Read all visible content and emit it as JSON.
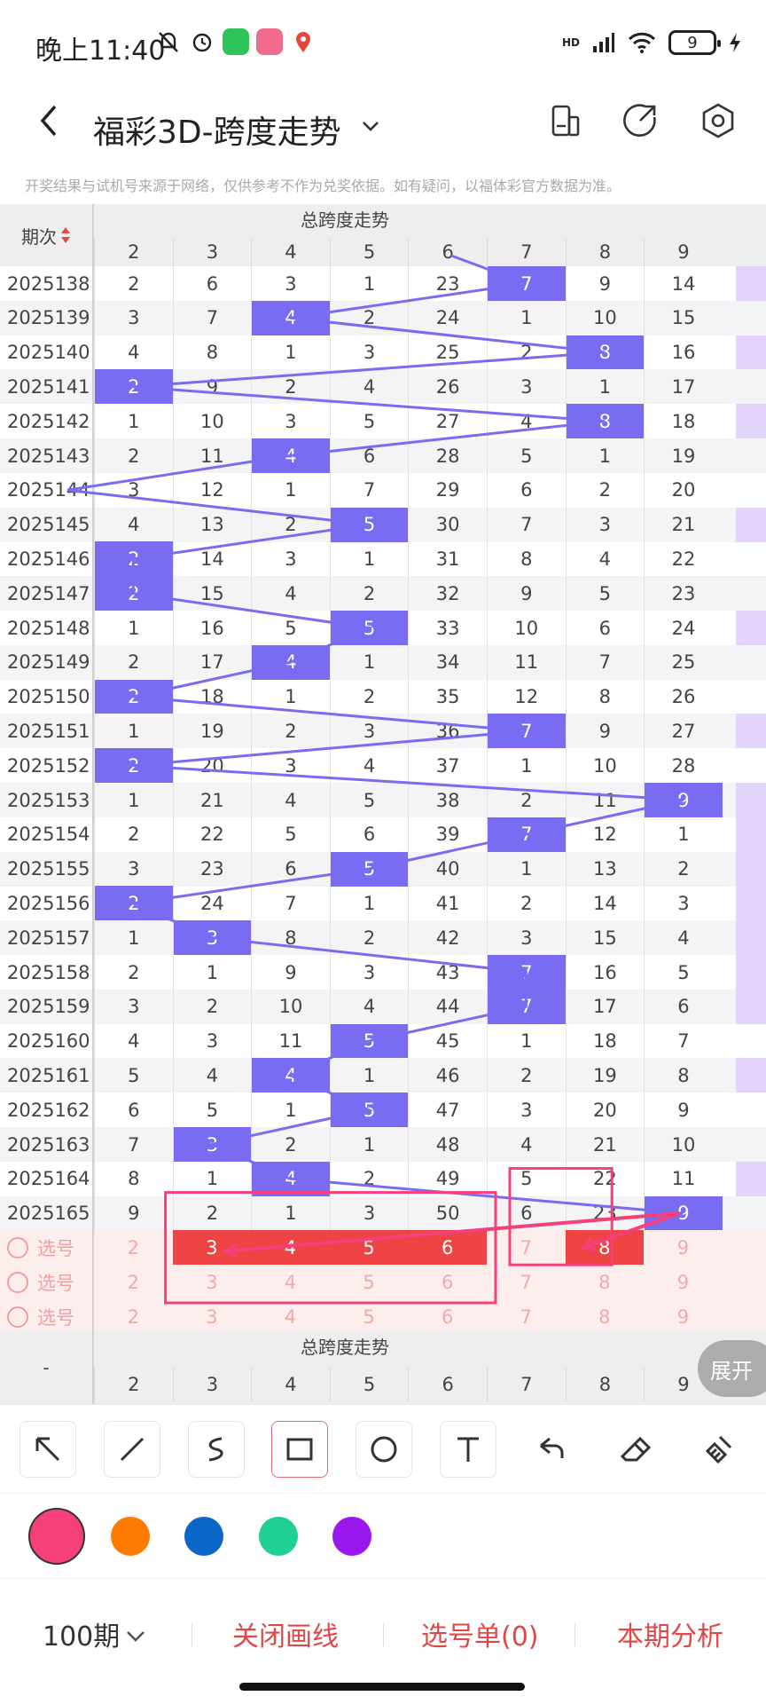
{
  "status_bar": {
    "time": "晚上11:40",
    "network": "HD",
    "battery": "9"
  },
  "header": {
    "title": "福彩3D-跨度走势",
    "notice": "开奖结果与试机号来源于网络，仅供参考不作为兑奖依据。如有疑问，以福体彩官方数据为准。"
  },
  "table": {
    "section_title": "总跨度走势",
    "period_header": "期次",
    "columns": [
      "2",
      "3",
      "4",
      "5",
      "6",
      "7",
      "8",
      "9"
    ],
    "rows": [
      {
        "period": "2025138",
        "vals": [
          "2",
          "6",
          "3",
          "1",
          "23",
          "7",
          "9",
          "14"
        ],
        "hit": 5
      },
      {
        "period": "2025139",
        "vals": [
          "3",
          "7",
          "4",
          "2",
          "24",
          "1",
          "10",
          "15"
        ],
        "hit": 2
      },
      {
        "period": "2025140",
        "vals": [
          "4",
          "8",
          "1",
          "3",
          "25",
          "2",
          "8",
          "16"
        ],
        "hit": 6
      },
      {
        "period": "2025141",
        "vals": [
          "2",
          "9",
          "2",
          "4",
          "26",
          "3",
          "1",
          "17"
        ],
        "hit": 0
      },
      {
        "period": "2025142",
        "vals": [
          "1",
          "10",
          "3",
          "5",
          "27",
          "4",
          "8",
          "18"
        ],
        "hit": 6
      },
      {
        "period": "2025143",
        "vals": [
          "2",
          "11",
          "4",
          "6",
          "28",
          "5",
          "1",
          "19"
        ],
        "hit": 2
      },
      {
        "period": "2025144",
        "vals": [
          "3",
          "12",
          "1",
          "7",
          "29",
          "6",
          "2",
          "20"
        ],
        "hit": -1
      },
      {
        "period": "2025145",
        "vals": [
          "4",
          "13",
          "2",
          "5",
          "30",
          "7",
          "3",
          "21"
        ],
        "hit": 3
      },
      {
        "period": "2025146",
        "vals": [
          "2",
          "14",
          "3",
          "1",
          "31",
          "8",
          "4",
          "22"
        ],
        "hit": 0
      },
      {
        "period": "2025147",
        "vals": [
          "2",
          "15",
          "4",
          "2",
          "32",
          "9",
          "5",
          "23"
        ],
        "hit": 0
      },
      {
        "period": "2025148",
        "vals": [
          "1",
          "16",
          "5",
          "5",
          "33",
          "10",
          "6",
          "24"
        ],
        "hit": 3
      },
      {
        "period": "2025149",
        "vals": [
          "2",
          "17",
          "4",
          "1",
          "34",
          "11",
          "7",
          "25"
        ],
        "hit": 2
      },
      {
        "period": "2025150",
        "vals": [
          "2",
          "18",
          "1",
          "2",
          "35",
          "12",
          "8",
          "26"
        ],
        "hit": 0
      },
      {
        "period": "2025151",
        "vals": [
          "1",
          "19",
          "2",
          "3",
          "36",
          "7",
          "9",
          "27"
        ],
        "hit": 5
      },
      {
        "period": "2025152",
        "vals": [
          "2",
          "20",
          "3",
          "4",
          "37",
          "1",
          "10",
          "28"
        ],
        "hit": 0
      },
      {
        "period": "2025153",
        "vals": [
          "1",
          "21",
          "4",
          "5",
          "38",
          "2",
          "11",
          "9"
        ],
        "hit": 7
      },
      {
        "period": "2025154",
        "vals": [
          "2",
          "22",
          "5",
          "6",
          "39",
          "7",
          "12",
          "1"
        ],
        "hit": 5
      },
      {
        "period": "2025155",
        "vals": [
          "3",
          "23",
          "6",
          "5",
          "40",
          "1",
          "13",
          "2"
        ],
        "hit": 3
      },
      {
        "period": "2025156",
        "vals": [
          "2",
          "24",
          "7",
          "1",
          "41",
          "2",
          "14",
          "3"
        ],
        "hit": 0
      },
      {
        "period": "2025157",
        "vals": [
          "1",
          "3",
          "8",
          "2",
          "42",
          "3",
          "15",
          "4"
        ],
        "hit": 1
      },
      {
        "period": "2025158",
        "vals": [
          "2",
          "1",
          "9",
          "3",
          "43",
          "7",
          "16",
          "5"
        ],
        "hit": 5
      },
      {
        "period": "2025159",
        "vals": [
          "3",
          "2",
          "10",
          "4",
          "44",
          "7",
          "17",
          "6"
        ],
        "hit": 5
      },
      {
        "period": "2025160",
        "vals": [
          "4",
          "3",
          "11",
          "5",
          "45",
          "1",
          "18",
          "7"
        ],
        "hit": 3
      },
      {
        "period": "2025161",
        "vals": [
          "5",
          "4",
          "4",
          "1",
          "46",
          "2",
          "19",
          "8"
        ],
        "hit": 2
      },
      {
        "period": "2025162",
        "vals": [
          "6",
          "5",
          "1",
          "5",
          "47",
          "3",
          "20",
          "9"
        ],
        "hit": 3
      },
      {
        "period": "2025163",
        "vals": [
          "7",
          "3",
          "2",
          "1",
          "48",
          "4",
          "21",
          "10"
        ],
        "hit": 1
      },
      {
        "period": "2025164",
        "vals": [
          "8",
          "1",
          "4",
          "2",
          "49",
          "5",
          "22",
          "11"
        ],
        "hit": 2
      },
      {
        "period": "2025165",
        "vals": [
          "9",
          "2",
          "1",
          "3",
          "50",
          "6",
          "23",
          "9"
        ],
        "hit": 7
      }
    ],
    "select_rows": [
      {
        "label": "选号",
        "vals": [
          "2",
          "3",
          "4",
          "5",
          "6",
          "7",
          "8",
          "9"
        ]
      },
      {
        "label": "选号",
        "vals": [
          "2",
          "3",
          "4",
          "5",
          "6",
          "7",
          "8",
          "9"
        ]
      },
      {
        "label": "选号",
        "vals": [
          "2",
          "3",
          "4",
          "5",
          "6",
          "7",
          "8",
          "9"
        ]
      }
    ],
    "footer_title": "总跨度走势",
    "footer_period": "-",
    "footer_columns": [
      "2",
      "3",
      "4",
      "5",
      "6",
      "7",
      "8",
      "9"
    ],
    "expand_label": "展开"
  },
  "tools": [
    "arrow",
    "line",
    "freehand",
    "rectangle",
    "circle",
    "text",
    "undo",
    "eraser",
    "clear"
  ],
  "colors": [
    "#f5407a",
    "#ff7a00",
    "#0a66c8",
    "#1ecf96",
    "#9a18ee"
  ],
  "bottom": {
    "period_count": "100期",
    "close_lines": "关闭画线",
    "selection": "选号单(0)",
    "analysis": "本期分析"
  }
}
